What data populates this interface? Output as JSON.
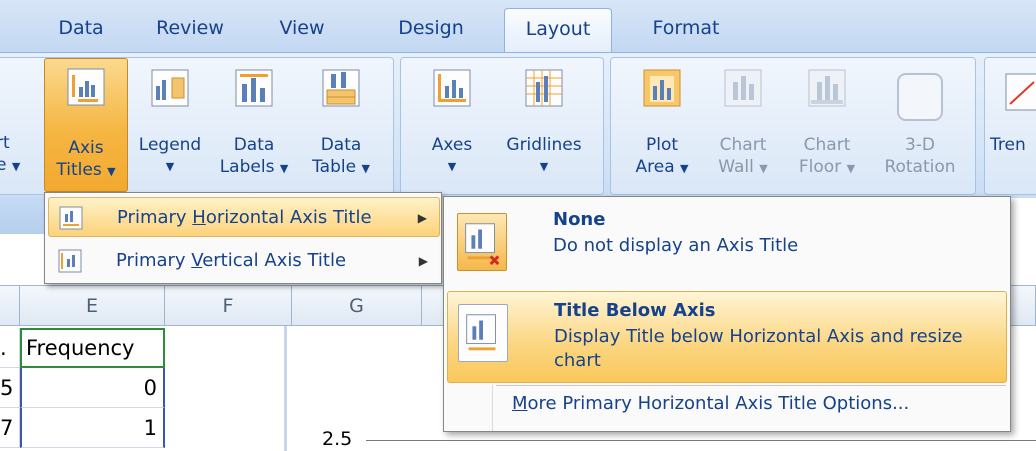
{
  "tabs": [
    "Data",
    "Review",
    "View",
    "Design",
    "Layout",
    "Format"
  ],
  "active_tab": "Layout",
  "ribbon": {
    "chart_title_partial_1": "rt",
    "chart_title_partial_2": "e",
    "axis_titles": [
      "Axis",
      "Titles"
    ],
    "legend": "Legend",
    "data_labels": [
      "Data",
      "Labels"
    ],
    "data_table": [
      "Data",
      "Table"
    ],
    "axes": "Axes",
    "gridlines": "Gridlines",
    "plot_area": [
      "Plot",
      "Area"
    ],
    "chart_wall": [
      "Chart",
      "Wall"
    ],
    "chart_floor": [
      "Chart",
      "Floor"
    ],
    "rotation_3d": [
      "3-D",
      "Rotation"
    ],
    "trendline_partial": "Tren"
  },
  "submenu": {
    "primary_horizontal": {
      "pre": "Primary ",
      "ul": "H",
      "post": "orizontal Axis Title"
    },
    "primary_vertical": {
      "pre": "Primary ",
      "ul": "V",
      "post": "ertical Axis Title"
    }
  },
  "options": [
    {
      "title": "None",
      "desc": "Do not display an Axis Title"
    },
    {
      "title": "Title Below Axis",
      "desc": "Display Title below Horizontal Axis and resize chart"
    }
  ],
  "more_options": {
    "ul": "M",
    "rest": "ore Primary Horizontal Axis Title Options..."
  },
  "sheet": {
    "columns": [
      "E",
      "F",
      "G"
    ],
    "header_cell": "Frequency",
    "row_prefix": [
      ".",
      "5",
      "7"
    ],
    "values": [
      "0",
      "1"
    ],
    "axis_tick": "2.5"
  }
}
